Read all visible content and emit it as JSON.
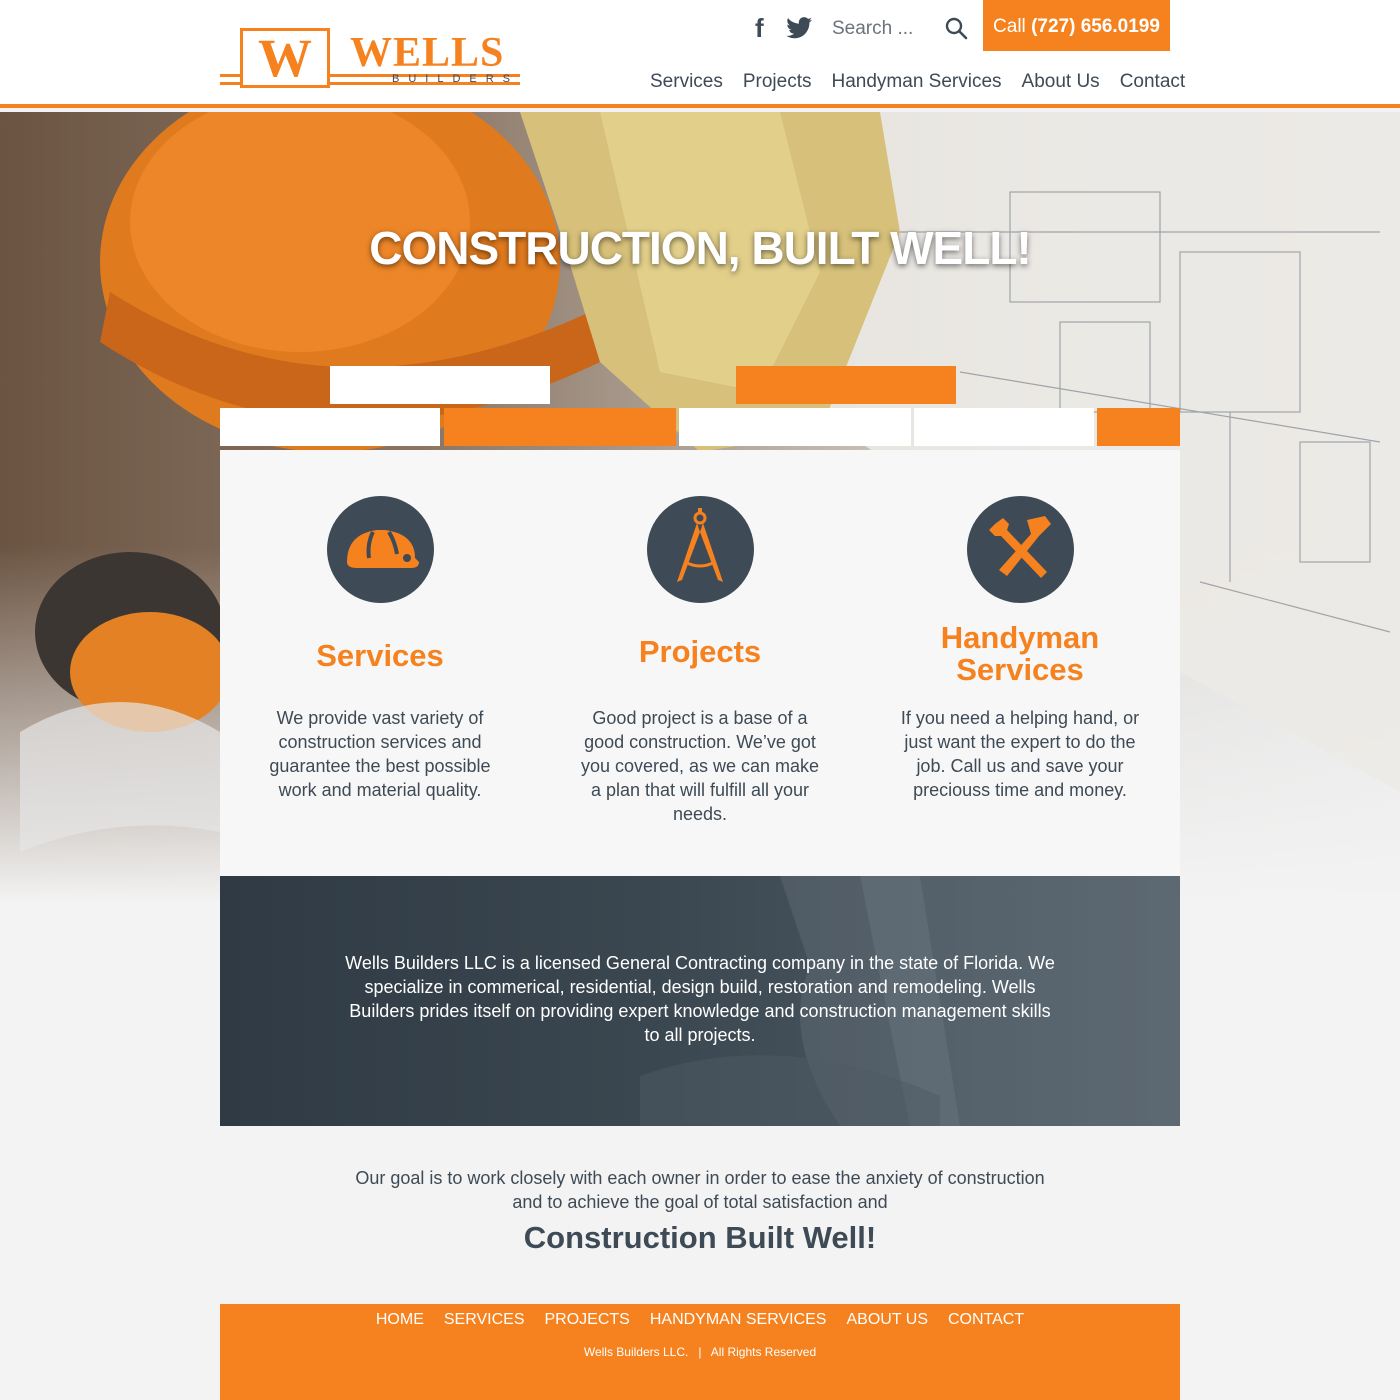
{
  "header": {
    "logo_letter": "W",
    "logo_word": "WELLS",
    "logo_sub": "BUILDERS",
    "search_placeholder": "Search ...",
    "call_prefix": "Call",
    "call_number": "(727) 656.0199",
    "nav": [
      "Services",
      "Projects",
      "Handyman Services",
      "About Us",
      "Contact"
    ],
    "social_icons": [
      "facebook-icon",
      "twitter-icon"
    ]
  },
  "hero": {
    "title": "CONSTRUCTION, BUILT WELL!"
  },
  "features": [
    {
      "icon": "hard-hat-icon",
      "title": "Services",
      "text": "We provide vast variety of construction services and guarantee the best possible work and material quality."
    },
    {
      "icon": "drafting-compass-icon",
      "title": "Projects",
      "text": "Good project is a base of a good construction. We’ve got you covered, as we can make a plan that will fulfill all your needs."
    },
    {
      "icon": "tools-icon",
      "title": "Handyman Services",
      "text": "If you need a helping hand, or just want the expert to do the job. Call us and save your preciouss time and money."
    }
  ],
  "about": {
    "text": "Wells Builders LLC is a licensed General Contracting company in the state of Florida. We specialize in commerical, residential, design build, restoration and remodeling. Wells Builders prides itself on providing expert knowledge and construction management skills to all projects."
  },
  "goal": {
    "text": "Our goal is to work closely with each owner in order to ease the anxiety of construction and to achieve the goal of total satisfaction and",
    "title": "Construction Built Well!"
  },
  "footer": {
    "nav": [
      "HOME",
      "SERVICES",
      "PROJECTS",
      "HANDYMAN SERVICES",
      "ABOUT US",
      "CONTACT"
    ],
    "copyright": "Wells Builders LLC.   |   All Rights Reserved"
  },
  "colors": {
    "accent": "#f5821f",
    "dark": "#3e4a55",
    "background": "#f3f3f3"
  }
}
